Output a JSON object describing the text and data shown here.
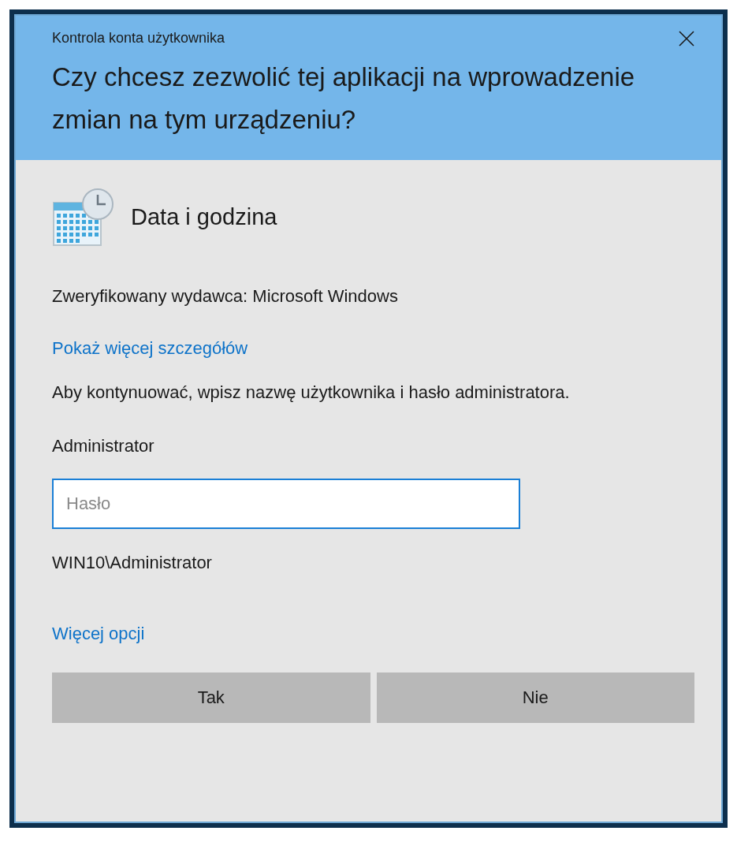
{
  "window": {
    "title": "Kontrola konta użytkownika"
  },
  "question": "Czy chcesz zezwolić tej aplikacji na wprowadzenie zmian na tym urządzeniu?",
  "app": {
    "name": "Data i godzina"
  },
  "publisher": "Zweryfikowany wydawca: Microsoft Windows",
  "details_link": "Pokaż więcej szczegółów",
  "instruction": "Aby kontynuować, wpisz nazwę użytkownika i hasło administratora.",
  "account": {
    "name": "Administrator",
    "domain": "WIN10\\Administrator"
  },
  "password_field": {
    "placeholder": "Hasło",
    "focused": true
  },
  "more_options_link": "Więcej opcji",
  "buttons": [
    {
      "label": "Tak"
    },
    {
      "label": "Nie"
    }
  ]
}
